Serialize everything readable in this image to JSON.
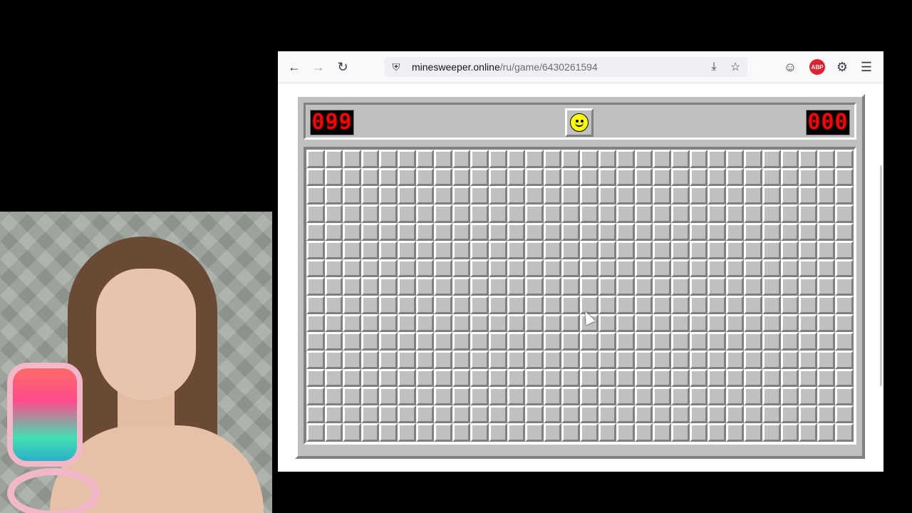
{
  "browser": {
    "url_host": "minesweeper.online",
    "url_path": "/ru/game/6430261594",
    "extension_badge": "ABP"
  },
  "game": {
    "mines_left": "099",
    "timer": "000",
    "face_state": "smile",
    "rows": 16,
    "cols": 30,
    "cells_state": "all-closed"
  },
  "icons": {
    "back": "arrow-left-icon",
    "forward": "arrow-right-icon",
    "reload": "reload-icon",
    "shield": "shield-icon",
    "save": "save-to-disk-icon",
    "bookmark": "star-icon",
    "account": "account-icon",
    "extensions": "puzzle-icon",
    "menu": "hamburger-menu-icon"
  },
  "colors": {
    "counter_digit": "#ff0000",
    "counter_bg": "#000000",
    "board": "#c0c0c0",
    "face": "#ffff00",
    "abp": "#e0202e"
  }
}
